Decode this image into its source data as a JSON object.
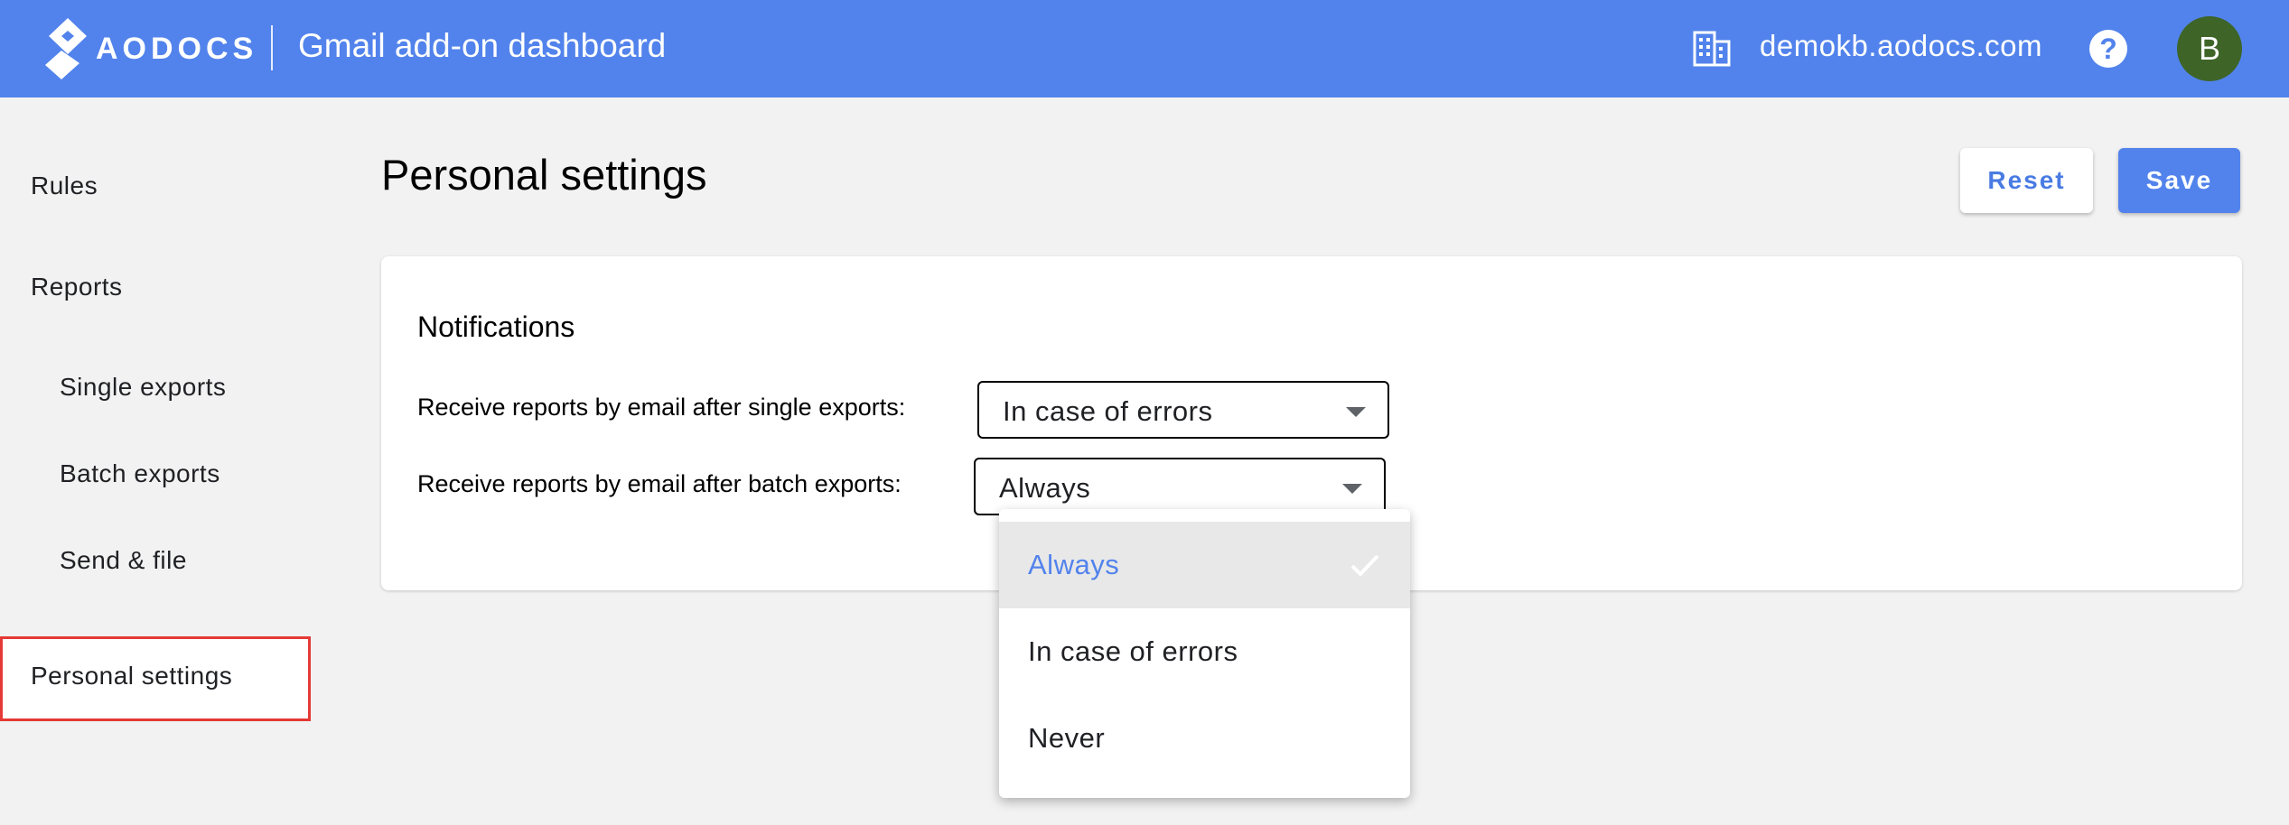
{
  "header": {
    "logo_text": "AODOCS",
    "app_title": "Gmail add-on dashboard",
    "domain": "demokb.aodocs.com",
    "help_label": "?",
    "avatar_initial": "B",
    "icons": {
      "domain": "building-icon",
      "help": "help-icon"
    },
    "background_color": "#5283ec"
  },
  "sidebar": {
    "items": [
      {
        "label": "Rules"
      },
      {
        "label": "Reports"
      },
      {
        "label": "Single exports"
      },
      {
        "label": "Batch exports"
      },
      {
        "label": "Send & file"
      },
      {
        "label": "Personal settings",
        "selected": true
      }
    ],
    "selected_outline_color": "#e53935"
  },
  "main": {
    "title": "Personal settings",
    "reset_label": "Reset",
    "save_label": "Save",
    "notifications": {
      "title": "Notifications",
      "single_label": "Receive reports by email after single exports:",
      "single_value": "In case of errors",
      "batch_label": "Receive reports by email after batch exports:",
      "batch_value": "Always"
    }
  },
  "dropdown": {
    "options": [
      {
        "label": "Always",
        "selected": true
      },
      {
        "label": "In case of errors"
      },
      {
        "label": "Never"
      }
    ],
    "accent_color": "#5283ec"
  }
}
